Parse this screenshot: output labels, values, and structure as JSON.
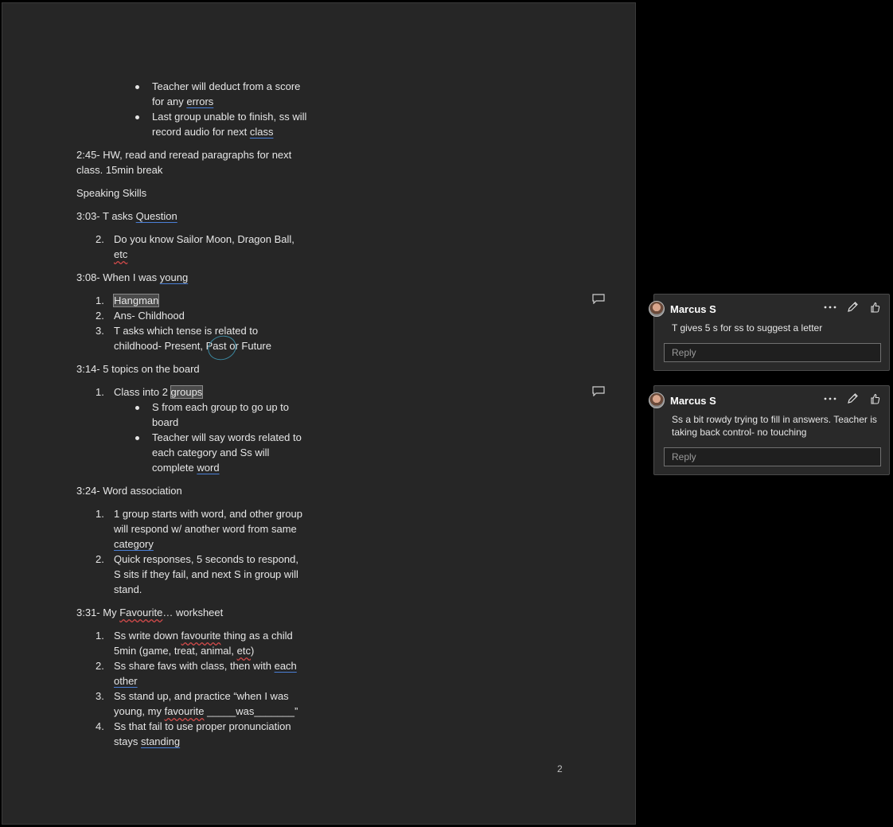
{
  "document": {
    "bullets_top": [
      {
        "text": "Teacher will deduct from a score for any ",
        "link": "errors"
      },
      {
        "text": "Last group unable to finish, ss will record audio for next ",
        "link": "class"
      }
    ],
    "p_hw": "2:45- HW, read and reread paragraphs for next class. 15min break",
    "p_speaking": "Speaking Skills",
    "p_question_prefix": "3:03- T asks ",
    "p_question_link": "Question",
    "q_item_num": "2.",
    "q_item_text": "Do you know Sailor Moon, Dragon Ball, ",
    "q_item_etc": "etc",
    "p_young_prefix": "3:08- When I was ",
    "p_young_link": "young",
    "young_list": {
      "n1": "1.",
      "t1": "Hangman",
      "n2": "2.",
      "t2": "Ans- Childhood",
      "n3": "3.",
      "t3": "T asks which tense is related to childhood- Present, Past or Future"
    },
    "p_topics": "3:14- 5 topics on the board",
    "topics_num": "1.",
    "topics_text_prefix": "Class into 2 ",
    "topics_text_hl": "groups",
    "topics_bullets": [
      {
        "text": "S from each group to go up to board"
      },
      {
        "text": "Teacher will say words related to each category and Ss will complete ",
        "link": "word"
      }
    ],
    "p_word_assoc": "3:24- Word association",
    "assoc_list": [
      {
        "num": "1.",
        "text": "1 group starts with word, and other group will respond w/ another word from same ",
        "link": "category"
      },
      {
        "num": "2.",
        "text": "Quick responses, 5 seconds to respond, S sits if they fail, and next S in group will stand."
      }
    ],
    "p_fav_prefix": "3:31- My ",
    "p_fav_word": "Favourite",
    "p_fav_suffix": "… worksheet",
    "fav_list": {
      "n1": "1.",
      "t1a": "Ss write down ",
      "t1b": "favourite",
      "t1c": " thing as a child 5min (game, treat, animal, ",
      "t1d": "etc",
      "t1e": ")",
      "n2": "2.",
      "t2a": "Ss share favs with class, then with ",
      "t2b": "each other",
      "n3": "3.",
      "t3a": "Ss stand up, and practice “when I was young, my ",
      "t3b": "favourite",
      "t3c": " _____was_______”",
      "n4": "4.",
      "t4a": "Ss that fail to use proper pronunciation stays ",
      "t4b": "standing"
    },
    "page_number": "2"
  },
  "comments": [
    {
      "author": "Marcus S",
      "text": "T gives 5 s for ss to suggest a letter",
      "reply_placeholder": "Reply"
    },
    {
      "author": "Marcus S",
      "text": "Ss a bit rowdy trying to fill in answers.  Teacher is taking back control- no touching",
      "reply_placeholder": "Reply"
    }
  ],
  "colors": {
    "page": "#262626",
    "background": "#000000",
    "underline_blue": "#4a7fd6",
    "squiggle_red": "#d04a4a"
  }
}
